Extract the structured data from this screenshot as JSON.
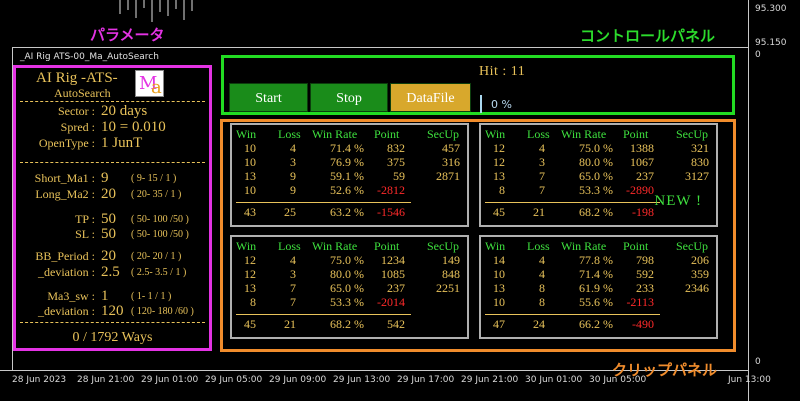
{
  "chart": {
    "symbol": "_AI Rig ATS-00_Ma_AutoSearch",
    "price_ticks": [
      "95.300",
      "95.150",
      "0"
    ],
    "time_ticks": [
      "28 Jun 2023",
      "28 Jun 21:00",
      "29 Jun 01:00",
      "29 Jun 05:00",
      "29 Jun 09:00",
      "29 Jun 13:00",
      "29 Jun 17:00",
      "29 Jun 21:00",
      "30 Jun 01:00",
      "30 Jun 05:00",
      "Jun 13:00"
    ]
  },
  "titles": {
    "params": "パラメータ",
    "control": "コントロールパネル",
    "clip": "クリップパネル"
  },
  "params": {
    "app_title": "AI Rig -ATS-",
    "app_subtitle": "AutoSearch",
    "logo_text": "Ma",
    "rows": [
      {
        "label": "Sector :",
        "value": "20 days"
      },
      {
        "label": "Spred :",
        "value": "10 = 0.010"
      },
      {
        "label": "OpenType :",
        "value": "1  JunT"
      },
      {
        "label": "Short_Ma1 :",
        "value": "9",
        "range": "( 9- 15 / 1 )"
      },
      {
        "label": "Long_Ma2 :",
        "value": "20",
        "range": "( 20- 35 / 1 )"
      },
      {
        "label": "TP :",
        "value": "50",
        "range": "( 50- 100 /50 )"
      },
      {
        "label": "SL :",
        "value": "50",
        "range": "( 50- 100 /50 )"
      },
      {
        "label": "BB_Period :",
        "value": "20",
        "range": "( 20- 20 / 1 )"
      },
      {
        "label": "_deviation :",
        "value": "2.5",
        "range": "( 2.5- 3.5 / 1 )"
      },
      {
        "label": "Ma3_sw :",
        "value": "1",
        "range": "( 1- 1 / 1 )"
      },
      {
        "label": "_deviation :",
        "value": "120",
        "range": "( 120- 180 /60 )"
      }
    ],
    "ways": "0 / 1792 Ways"
  },
  "control": {
    "hit": "Hit : 11",
    "buttons": {
      "start": "Start",
      "stop": "Stop",
      "datafile": "DataFile"
    },
    "progress_percent": 0,
    "progress_text": "0 %"
  },
  "clip": {
    "headers": {
      "win": "Win",
      "loss": "Loss",
      "rate": "Win Rate",
      "point": "Point",
      "secup": "SecUp"
    },
    "new_badge": "NEW !",
    "colors": {
      "positive": "#e8c25a",
      "negative": "#ff2a2a",
      "header": "#3ee03e"
    },
    "boxes": [
      {
        "rows": [
          {
            "win": "10",
            "loss": "4",
            "rate": "71.4 %",
            "point": "832",
            "secup": "457"
          },
          {
            "win": "10",
            "loss": "3",
            "rate": "76.9 %",
            "point": "375",
            "secup": "316"
          },
          {
            "win": "13",
            "loss": "9",
            "rate": "59.1 %",
            "point": "59",
            "secup": "2871"
          },
          {
            "win": "10",
            "loss": "9",
            "rate": "52.6 %",
            "point": "-2812",
            "secup": ""
          }
        ],
        "total": {
          "win": "43",
          "loss": "25",
          "rate": "63.2 %",
          "point": "-1546",
          "secup": ""
        }
      },
      {
        "rows": [
          {
            "win": "12",
            "loss": "4",
            "rate": "75.0 %",
            "point": "1388",
            "secup": "321"
          },
          {
            "win": "12",
            "loss": "3",
            "rate": "80.0 %",
            "point": "1067",
            "secup": "830"
          },
          {
            "win": "13",
            "loss": "7",
            "rate": "65.0 %",
            "point": "237",
            "secup": "3127"
          },
          {
            "win": "8",
            "loss": "7",
            "rate": "53.3 %",
            "point": "-2890",
            "secup": ""
          }
        ],
        "total": {
          "win": "45",
          "loss": "21",
          "rate": "68.2 %",
          "point": "-198",
          "secup": ""
        }
      },
      {
        "rows": [
          {
            "win": "12",
            "loss": "4",
            "rate": "75.0 %",
            "point": "1234",
            "secup": "149"
          },
          {
            "win": "12",
            "loss": "3",
            "rate": "80.0 %",
            "point": "1085",
            "secup": "848"
          },
          {
            "win": "13",
            "loss": "7",
            "rate": "65.0 %",
            "point": "237",
            "secup": "2251"
          },
          {
            "win": "8",
            "loss": "7",
            "rate": "53.3 %",
            "point": "-2014",
            "secup": ""
          }
        ],
        "total": {
          "win": "45",
          "loss": "21",
          "rate": "68.2 %",
          "point": "542",
          "secup": ""
        }
      },
      {
        "rows": [
          {
            "win": "14",
            "loss": "4",
            "rate": "77.8 %",
            "point": "798",
            "secup": "206"
          },
          {
            "win": "10",
            "loss": "4",
            "rate": "71.4 %",
            "point": "592",
            "secup": "359"
          },
          {
            "win": "13",
            "loss": "8",
            "rate": "61.9 %",
            "point": "233",
            "secup": "2346"
          },
          {
            "win": "10",
            "loss": "8",
            "rate": "55.6 %",
            "point": "-2113",
            "secup": ""
          }
        ],
        "total": {
          "win": "47",
          "loss": "24",
          "rate": "66.2 %",
          "point": "-490",
          "secup": ""
        }
      }
    ]
  }
}
